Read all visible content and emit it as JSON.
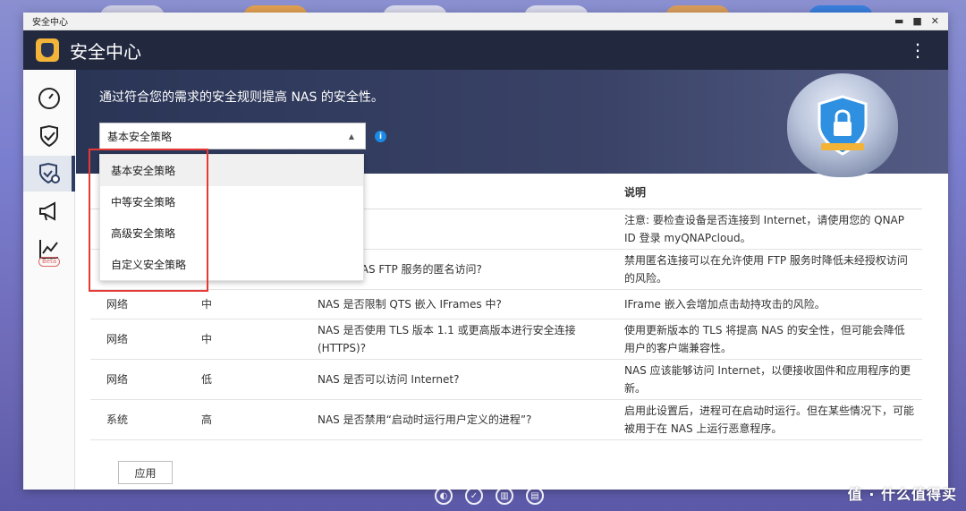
{
  "window": {
    "titlebar_title": "安全中心",
    "title": "安全中心"
  },
  "banner": {
    "description": "通过符合您的需求的安全规则提高 NAS 的安全性。",
    "policy_selected": "基本安全策略"
  },
  "dropdown": {
    "options": [
      "基本安全策略",
      "中等安全策略",
      "高级安全策略",
      "自定义安全策略"
    ]
  },
  "table": {
    "header_description": "说明",
    "rows": [
      {
        "category": "",
        "level": "",
        "check": "",
        "description": "注意: 要检查设备是否连接到 Internet，请使用您的 QNAP ID 登录 myQNAPcloud。"
      },
      {
        "category": "",
        "level": "",
        "check": "禁用对 NAS FTP 服务的匿名访问?",
        "description": "禁用匿名连接可以在允许使用 FTP 服务时降低未经授权访问的风险。"
      },
      {
        "category": "网络",
        "level": "中",
        "check": "NAS 是否限制 QTS 嵌入 IFrames 中?",
        "description": "IFrame 嵌入会增加点击劫持攻击的风险。"
      },
      {
        "category": "网络",
        "level": "中",
        "check": "NAS 是否使用 TLS 版本 1.1 或更高版本进行安全连接 (HTTPS)?",
        "description": "使用更新版本的 TLS 将提高 NAS 的安全性，但可能会降低用户的客户端兼容性。"
      },
      {
        "category": "网络",
        "level": "低",
        "check": "NAS 是否可以访问 Internet?",
        "description": "NAS 应该能够访问 Internet，以便接收固件和应用程序的更新。"
      },
      {
        "category": "系统",
        "level": "高",
        "check": "NAS 是否禁用“启动时运行用户定义的进程”?",
        "description": "启用此设置后，进程可在启动时运行。但在某些情况下，可能被用于在 NAS 上运行恶意程序。"
      }
    ]
  },
  "buttons": {
    "apply": "应用"
  },
  "sidebar": {
    "beta_label": "Beta"
  },
  "watermark": "值 · 什么值得买"
}
